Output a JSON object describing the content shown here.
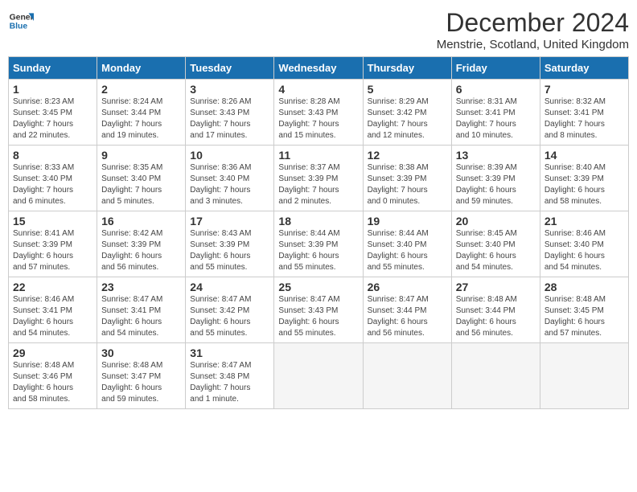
{
  "logo": {
    "line1": "General",
    "line2": "Blue"
  },
  "title": "December 2024",
  "subtitle": "Menstrie, Scotland, United Kingdom",
  "days_header": [
    "Sunday",
    "Monday",
    "Tuesday",
    "Wednesday",
    "Thursday",
    "Friday",
    "Saturday"
  ],
  "weeks": [
    [
      {
        "num": "1",
        "info": "Sunrise: 8:23 AM\nSunset: 3:45 PM\nDaylight: 7 hours\nand 22 minutes."
      },
      {
        "num": "2",
        "info": "Sunrise: 8:24 AM\nSunset: 3:44 PM\nDaylight: 7 hours\nand 19 minutes."
      },
      {
        "num": "3",
        "info": "Sunrise: 8:26 AM\nSunset: 3:43 PM\nDaylight: 7 hours\nand 17 minutes."
      },
      {
        "num": "4",
        "info": "Sunrise: 8:28 AM\nSunset: 3:43 PM\nDaylight: 7 hours\nand 15 minutes."
      },
      {
        "num": "5",
        "info": "Sunrise: 8:29 AM\nSunset: 3:42 PM\nDaylight: 7 hours\nand 12 minutes."
      },
      {
        "num": "6",
        "info": "Sunrise: 8:31 AM\nSunset: 3:41 PM\nDaylight: 7 hours\nand 10 minutes."
      },
      {
        "num": "7",
        "info": "Sunrise: 8:32 AM\nSunset: 3:41 PM\nDaylight: 7 hours\nand 8 minutes."
      }
    ],
    [
      {
        "num": "8",
        "info": "Sunrise: 8:33 AM\nSunset: 3:40 PM\nDaylight: 7 hours\nand 6 minutes."
      },
      {
        "num": "9",
        "info": "Sunrise: 8:35 AM\nSunset: 3:40 PM\nDaylight: 7 hours\nand 5 minutes."
      },
      {
        "num": "10",
        "info": "Sunrise: 8:36 AM\nSunset: 3:40 PM\nDaylight: 7 hours\nand 3 minutes."
      },
      {
        "num": "11",
        "info": "Sunrise: 8:37 AM\nSunset: 3:39 PM\nDaylight: 7 hours\nand 2 minutes."
      },
      {
        "num": "12",
        "info": "Sunrise: 8:38 AM\nSunset: 3:39 PM\nDaylight: 7 hours\nand 0 minutes."
      },
      {
        "num": "13",
        "info": "Sunrise: 8:39 AM\nSunset: 3:39 PM\nDaylight: 6 hours\nand 59 minutes."
      },
      {
        "num": "14",
        "info": "Sunrise: 8:40 AM\nSunset: 3:39 PM\nDaylight: 6 hours\nand 58 minutes."
      }
    ],
    [
      {
        "num": "15",
        "info": "Sunrise: 8:41 AM\nSunset: 3:39 PM\nDaylight: 6 hours\nand 57 minutes."
      },
      {
        "num": "16",
        "info": "Sunrise: 8:42 AM\nSunset: 3:39 PM\nDaylight: 6 hours\nand 56 minutes."
      },
      {
        "num": "17",
        "info": "Sunrise: 8:43 AM\nSunset: 3:39 PM\nDaylight: 6 hours\nand 55 minutes."
      },
      {
        "num": "18",
        "info": "Sunrise: 8:44 AM\nSunset: 3:39 PM\nDaylight: 6 hours\nand 55 minutes."
      },
      {
        "num": "19",
        "info": "Sunrise: 8:44 AM\nSunset: 3:40 PM\nDaylight: 6 hours\nand 55 minutes."
      },
      {
        "num": "20",
        "info": "Sunrise: 8:45 AM\nSunset: 3:40 PM\nDaylight: 6 hours\nand 54 minutes."
      },
      {
        "num": "21",
        "info": "Sunrise: 8:46 AM\nSunset: 3:40 PM\nDaylight: 6 hours\nand 54 minutes."
      }
    ],
    [
      {
        "num": "22",
        "info": "Sunrise: 8:46 AM\nSunset: 3:41 PM\nDaylight: 6 hours\nand 54 minutes."
      },
      {
        "num": "23",
        "info": "Sunrise: 8:47 AM\nSunset: 3:41 PM\nDaylight: 6 hours\nand 54 minutes."
      },
      {
        "num": "24",
        "info": "Sunrise: 8:47 AM\nSunset: 3:42 PM\nDaylight: 6 hours\nand 55 minutes."
      },
      {
        "num": "25",
        "info": "Sunrise: 8:47 AM\nSunset: 3:43 PM\nDaylight: 6 hours\nand 55 minutes."
      },
      {
        "num": "26",
        "info": "Sunrise: 8:47 AM\nSunset: 3:44 PM\nDaylight: 6 hours\nand 56 minutes."
      },
      {
        "num": "27",
        "info": "Sunrise: 8:48 AM\nSunset: 3:44 PM\nDaylight: 6 hours\nand 56 minutes."
      },
      {
        "num": "28",
        "info": "Sunrise: 8:48 AM\nSunset: 3:45 PM\nDaylight: 6 hours\nand 57 minutes."
      }
    ],
    [
      {
        "num": "29",
        "info": "Sunrise: 8:48 AM\nSunset: 3:46 PM\nDaylight: 6 hours\nand 58 minutes."
      },
      {
        "num": "30",
        "info": "Sunrise: 8:48 AM\nSunset: 3:47 PM\nDaylight: 6 hours\nand 59 minutes."
      },
      {
        "num": "31",
        "info": "Sunrise: 8:47 AM\nSunset: 3:48 PM\nDaylight: 7 hours\nand 1 minute."
      },
      {
        "num": "",
        "info": ""
      },
      {
        "num": "",
        "info": ""
      },
      {
        "num": "",
        "info": ""
      },
      {
        "num": "",
        "info": ""
      }
    ]
  ]
}
